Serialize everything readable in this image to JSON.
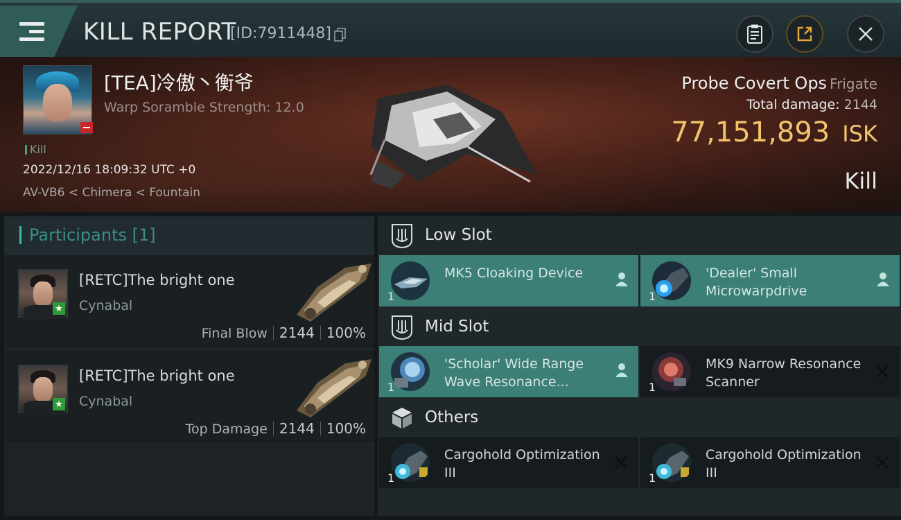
{
  "header": {
    "title": "KILL REPORT",
    "report_id": "[ID:7911448]",
    "icons": [
      "menu-icon",
      "copy-icon",
      "clipboard-icon",
      "share-icon",
      "close-icon"
    ]
  },
  "victim": {
    "name": "[TEA]冷傲丶衡爷",
    "sub_info": "Warp Soramble Strength: 12.0",
    "tag": "Kill",
    "datetime": "2022/12/16 18:09:32 UTC +0",
    "location": "AV-VB6 < Chimera < Fountain",
    "ship_name": "Probe Covert Ops",
    "ship_class": "Frigate",
    "total_damage_label": "Total damage:",
    "total_damage_value": "2144",
    "isk_value": "77,151,893",
    "isk_unit": "ISK",
    "result": "Kill"
  },
  "participants": {
    "label": "Participants",
    "count": "[1]",
    "rows": [
      {
        "name": "[RETC]The bright one",
        "ship": "Cynabal",
        "role": "Final Blow",
        "damage": "2144",
        "percent": "100%"
      },
      {
        "name": "[RETC]The bright one",
        "ship": "Cynabal",
        "role": "Top Damage",
        "damage": "2144",
        "percent": "100%"
      }
    ]
  },
  "slots": {
    "low": {
      "label": "Low Slot",
      "items": [
        {
          "name": "MK5 Cloaking Device",
          "qty": "1",
          "status": "dropped"
        },
        {
          "name": "'Dealer' Small Microwarpdrive",
          "qty": "1",
          "status": "dropped"
        }
      ]
    },
    "mid": {
      "label": "Mid Slot",
      "items": [
        {
          "name": "'Scholar' Wide Range Wave Resonance...",
          "qty": "1",
          "status": "dropped"
        },
        {
          "name": "MK9 Narrow Resonance Scanner",
          "qty": "1",
          "status": "destroyed"
        }
      ]
    },
    "others": {
      "label": "Others",
      "items": [
        {
          "name": "Cargohold Optimization III",
          "qty": "1",
          "status": "destroyed"
        },
        {
          "name": "Cargohold Optimization III",
          "qty": "1",
          "status": "destroyed"
        }
      ]
    }
  },
  "colors": {
    "accent_teal": "#3b7f76",
    "isk_gold": "#f2c46c",
    "participants_label": "#3b8d8a",
    "destroyed_bg": "#161b1d"
  }
}
